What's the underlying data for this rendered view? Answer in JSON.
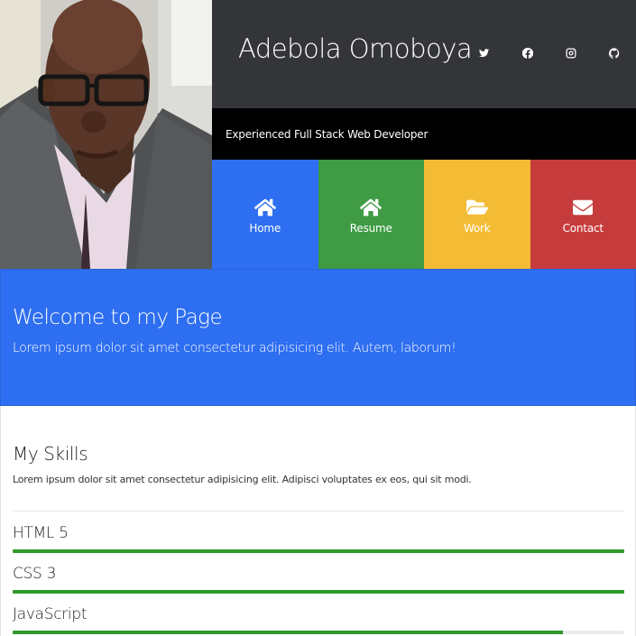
{
  "header": {
    "title": "Adebola Omoboya",
    "tagline": "Experienced Full Stack Web Developer",
    "socials": [
      {
        "icon": "twitter-icon"
      },
      {
        "icon": "facebook-icon"
      },
      {
        "icon": "instagram-icon"
      },
      {
        "icon": "github-icon"
      }
    ]
  },
  "nav": {
    "items": [
      {
        "label": "Home",
        "icon": "home-icon",
        "color": "#2e6ef0"
      },
      {
        "label": "Resume",
        "icon": "home-icon",
        "color": "#3f9b44"
      },
      {
        "label": "Work",
        "icon": "folder-open-icon",
        "color": "#f4bb35"
      },
      {
        "label": "Contact",
        "icon": "envelope-icon",
        "color": "#c63c3c"
      }
    ]
  },
  "welcome": {
    "title": "Welcome to my Page",
    "text": "Lorem ipsum dolor sit amet consectetur adipisicing elit. Autem, laborum!",
    "color": "#2e6ef0"
  },
  "skills": {
    "title": "My Skills",
    "intro": "Lorem ipsum dolor sit amet consectetur adipisicing elit. Adipisci voluptates ex eos, qui sit modi.",
    "items": [
      {
        "name": "HTML 5",
        "level": 100
      },
      {
        "name": "CSS 3",
        "level": 100
      },
      {
        "name": "JavaScript",
        "level": 90
      }
    ],
    "bar_color": "#2f9a2a"
  }
}
